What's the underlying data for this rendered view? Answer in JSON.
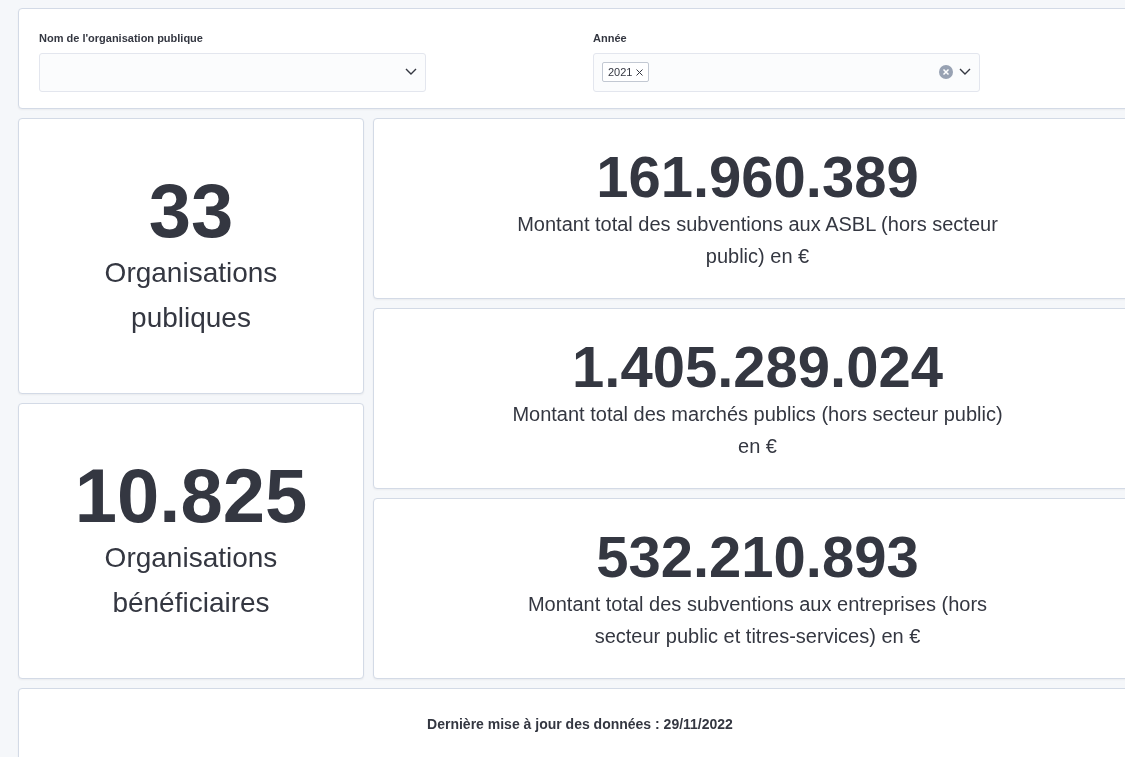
{
  "filters": [
    {
      "label": "Nom de l'organisation publique"
    },
    {
      "label": "Année",
      "tags": [
        "2021"
      ]
    }
  ],
  "left_metrics": [
    {
      "value": "33",
      "label": "Organisations publiques"
    },
    {
      "value": "10.825",
      "label": "Organisations bénéficiaires"
    }
  ],
  "right_metrics": [
    {
      "value": "161.960.389",
      "label": "Montant total des subventions aux ASBL (hors secteur public) en €"
    },
    {
      "value": "1.405.289.024",
      "label": "Montant total des marchés publics (hors secteur public) en €"
    },
    {
      "value": "532.210.893",
      "label": "Montant total des subventions aux entreprises (hors secteur public et titres-services) en €"
    }
  ],
  "footer": {
    "text": "Dernière mise à jour des données : 29/11/2022"
  }
}
